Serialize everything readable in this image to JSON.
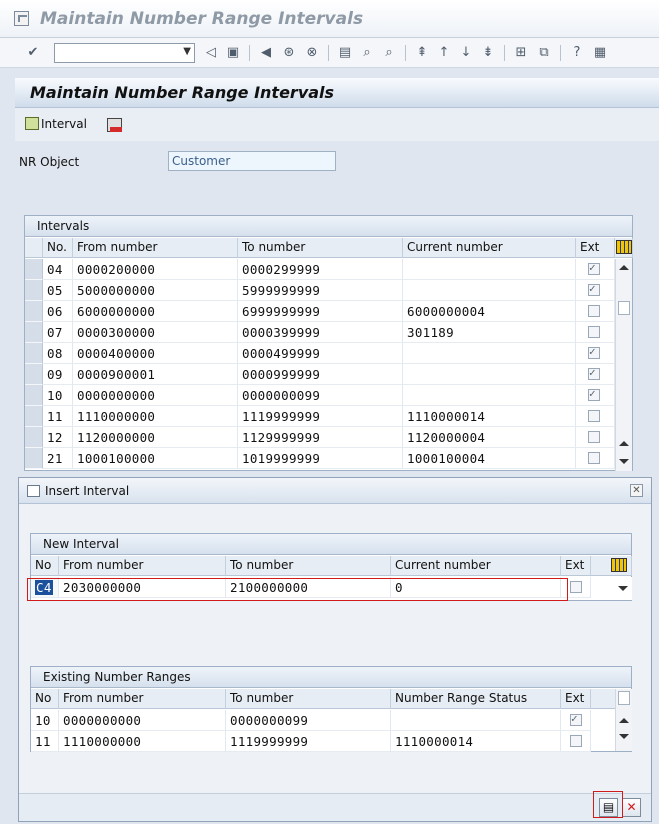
{
  "window": {
    "title": "Maintain Number Range Intervals"
  },
  "screen": {
    "title": "Maintain Number Range Intervals",
    "interval_button": "Interval"
  },
  "nr_object": {
    "label": "NR Object",
    "value": "Customer"
  },
  "intervals": {
    "title": "Intervals",
    "columns": [
      "No.",
      "From number",
      "To number",
      "Current number",
      "Ext"
    ],
    "rows": [
      {
        "no": "04",
        "from": "0000200000",
        "to": "0000299999",
        "current": "",
        "ext": true
      },
      {
        "no": "05",
        "from": "5000000000",
        "to": "5999999999",
        "current": "",
        "ext": true
      },
      {
        "no": "06",
        "from": "6000000000",
        "to": "6999999999",
        "current": "6000000004",
        "ext": false
      },
      {
        "no": "07",
        "from": "0000300000",
        "to": "0000399999",
        "current": "301189",
        "ext": false
      },
      {
        "no": "08",
        "from": "0000400000",
        "to": "0000499999",
        "current": "",
        "ext": true
      },
      {
        "no": "09",
        "from": "0000900001",
        "to": "0000999999",
        "current": "",
        "ext": true
      },
      {
        "no": "10",
        "from": "0000000000",
        "to": "0000000099",
        "current": "",
        "ext": true
      },
      {
        "no": "11",
        "from": "1110000000",
        "to": "1119999999",
        "current": "1110000014",
        "ext": false
      },
      {
        "no": "12",
        "from": "1120000000",
        "to": "1129999999",
        "current": "1120000004",
        "ext": false
      },
      {
        "no": "21",
        "from": "1000100000",
        "to": "1019999999",
        "current": "1000100004",
        "ext": false
      }
    ]
  },
  "dialog": {
    "title": "Insert Interval",
    "new_interval": {
      "title": "New Interval",
      "columns": [
        "No",
        "From number",
        "To number",
        "Current number",
        "Ext"
      ],
      "row": {
        "no": "C4",
        "from": "2030000000",
        "to": "2100000000",
        "current": "0",
        "ext": false
      }
    },
    "existing": {
      "title": "Existing Number Ranges",
      "columns": [
        "No",
        "From number",
        "To number",
        "Number Range Status",
        "Ext"
      ],
      "rows": [
        {
          "no": "10",
          "from": "0000000000",
          "to": "0000000099",
          "status": "",
          "ext": true
        },
        {
          "no": "11",
          "from": "1110000000",
          "to": "1119999999",
          "status": "1110000014",
          "ext": false
        }
      ]
    }
  },
  "colors": {
    "highlight_border": "#d11a1a",
    "header_bg": "#d6e1ee"
  }
}
